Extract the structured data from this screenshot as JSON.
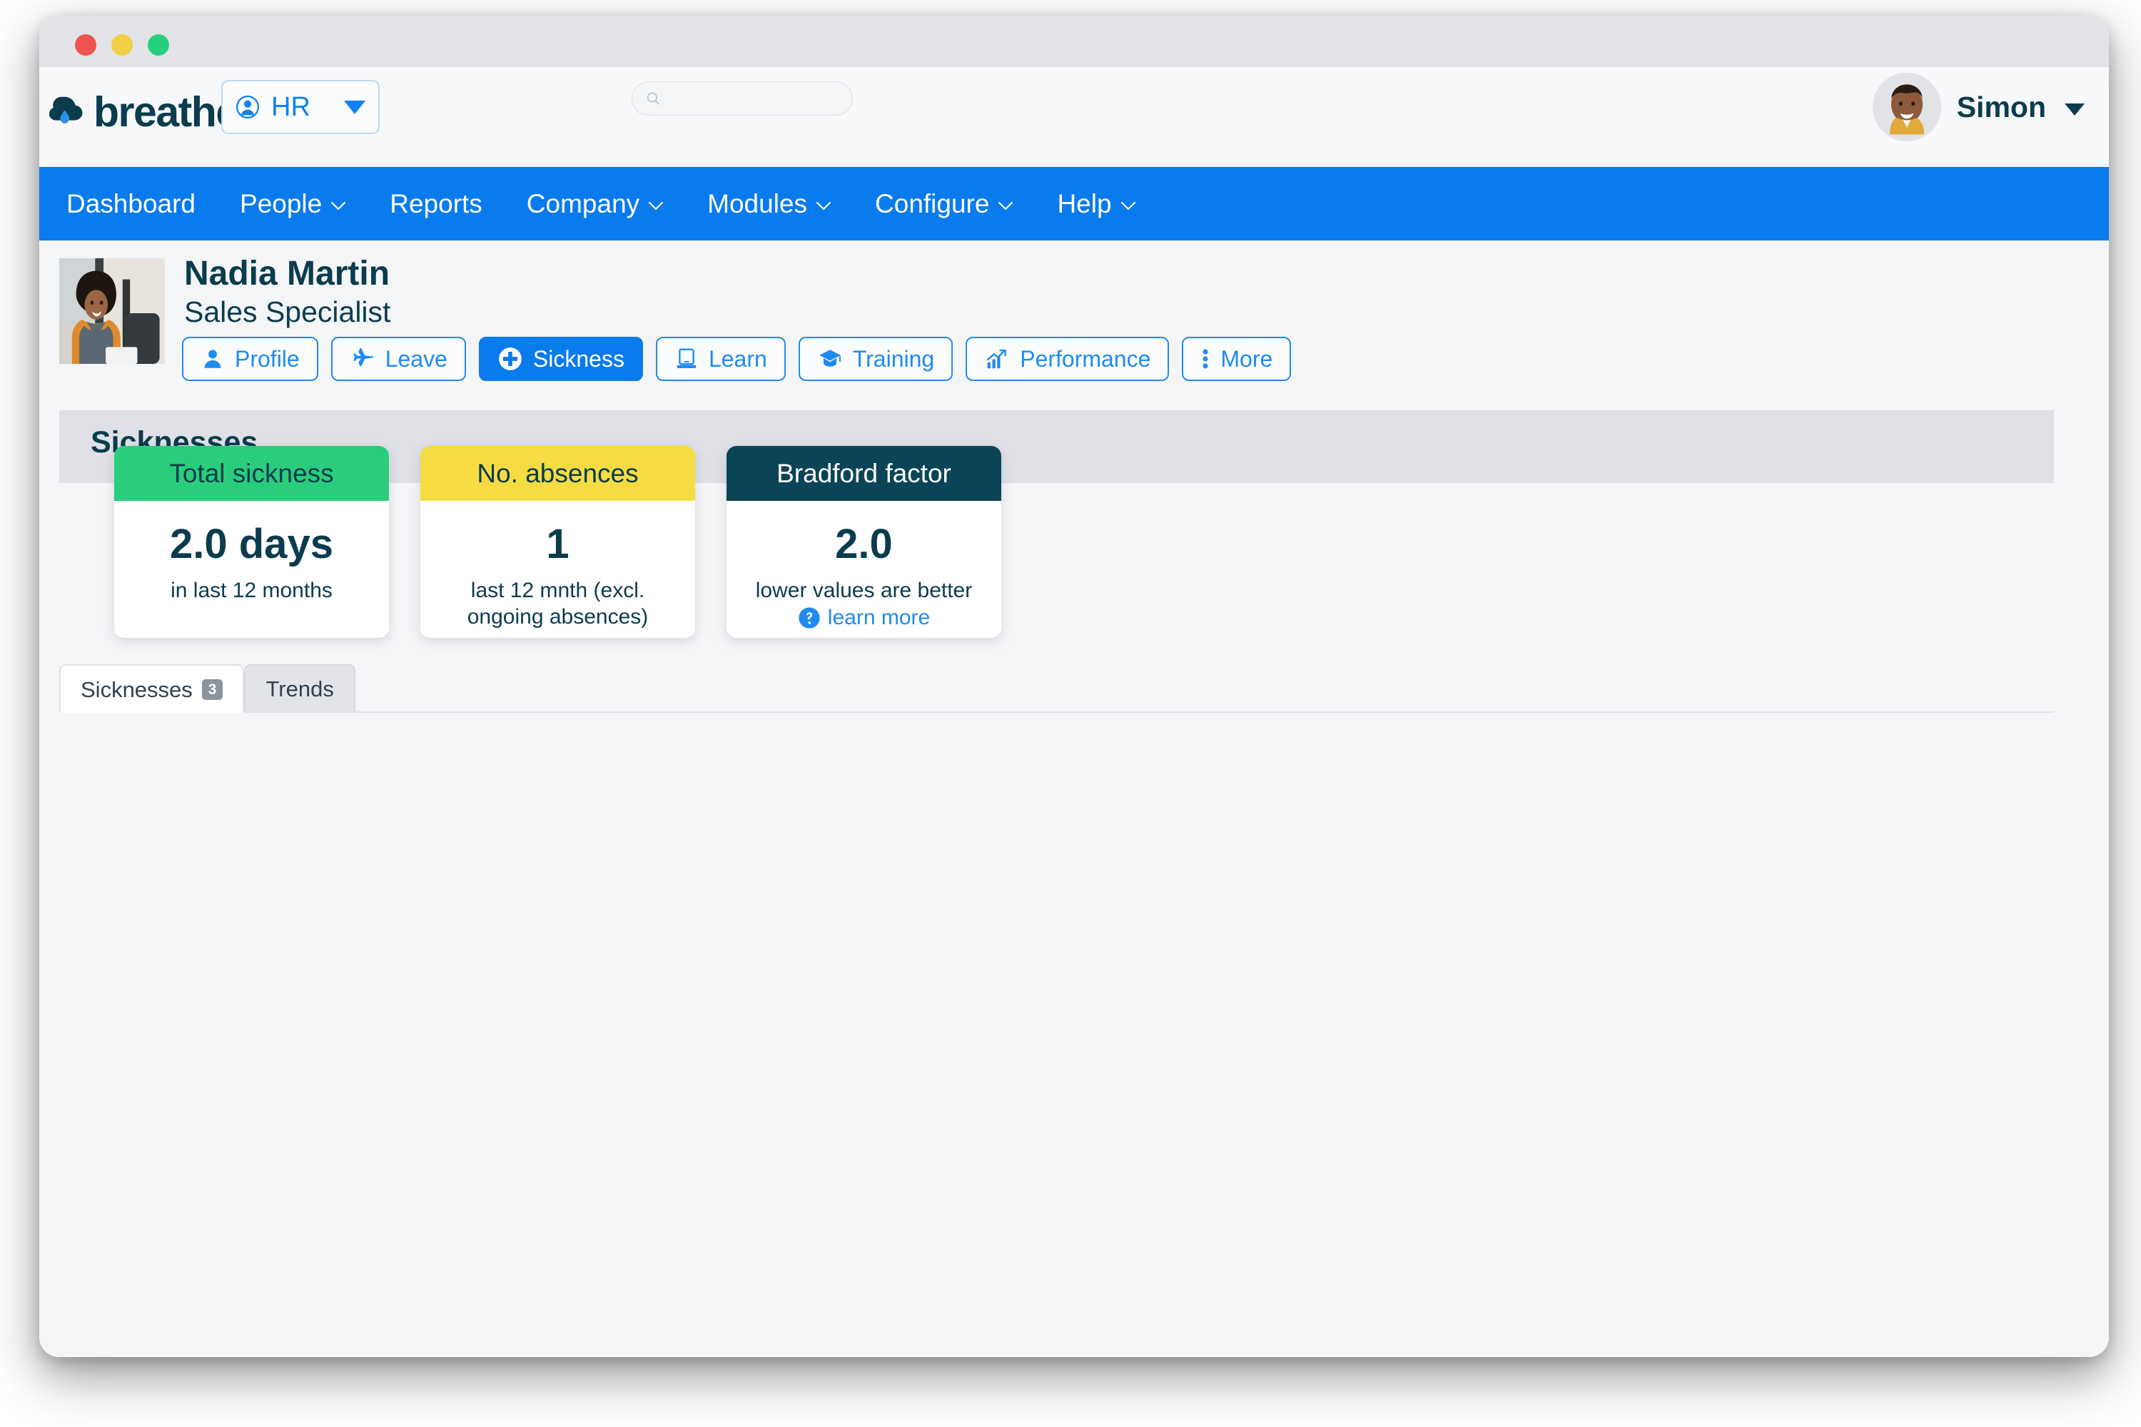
{
  "window": {
    "traffic_lights": [
      {
        "name": "close",
        "color": "#ef5350"
      },
      {
        "name": "minimize",
        "color": "#f0d044"
      },
      {
        "name": "maximize",
        "color": "#26cf7d"
      }
    ]
  },
  "header": {
    "logo_text": "breathe",
    "switcher": {
      "label": "HR"
    },
    "search": {
      "value": "",
      "placeholder": ""
    },
    "user": {
      "name": "Simon"
    }
  },
  "nav": {
    "items": [
      {
        "label": "Dashboard",
        "has_caret": false
      },
      {
        "label": "People",
        "has_caret": true
      },
      {
        "label": "Reports",
        "has_caret": false
      },
      {
        "label": "Company",
        "has_caret": true
      },
      {
        "label": "Modules",
        "has_caret": true
      },
      {
        "label": "Configure",
        "has_caret": true
      },
      {
        "label": "Help",
        "has_caret": true
      }
    ]
  },
  "profile": {
    "name": "Nadia Martin",
    "role": "Sales Specialist",
    "tabs": [
      {
        "label": "Profile",
        "icon": "person-icon",
        "active": false
      },
      {
        "label": "Leave",
        "icon": "airplane-icon",
        "active": false
      },
      {
        "label": "Sickness",
        "icon": "plus-circle-icon",
        "active": true
      },
      {
        "label": "Learn",
        "icon": "laptop-icon",
        "active": false
      },
      {
        "label": "Training",
        "icon": "graduation-cap-icon",
        "active": false
      },
      {
        "label": "Performance",
        "icon": "bar-chart-icon",
        "active": false
      },
      {
        "label": "More",
        "icon": "kebab-menu-icon",
        "active": false
      }
    ]
  },
  "section": {
    "title": "Sicknesses"
  },
  "cards": [
    {
      "title": "Total sickness",
      "value": "2.0 days",
      "caption": "in last 12 months",
      "header_color": "#2acd7c",
      "header_text_color": "#0b3c4d",
      "link": null
    },
    {
      "title": "No. absences",
      "value": "1",
      "caption": "last 12 mnth (excl. ongoing absences)",
      "header_color": "#f5dc42",
      "header_text_color": "#0b3c4d",
      "link": null
    },
    {
      "title": "Bradford factor",
      "value": "2.0",
      "caption": "lower values are better",
      "header_color": "#0b4457",
      "header_text_color": "#ffffff",
      "link": "learn more"
    }
  ],
  "bottom_tabs": [
    {
      "label": "Sicknesses",
      "badge": "3",
      "active": true
    },
    {
      "label": "Trends",
      "badge": null,
      "active": false
    }
  ],
  "colors": {
    "nav_blue": "#0a7bec",
    "accent_blue": "#1f8bf2",
    "navy": "#0b3c4d",
    "green": "#2acd7c",
    "yellow": "#f5dc42",
    "page_bg": "#f4f5f7",
    "band_gray": "#dfe1e6"
  }
}
